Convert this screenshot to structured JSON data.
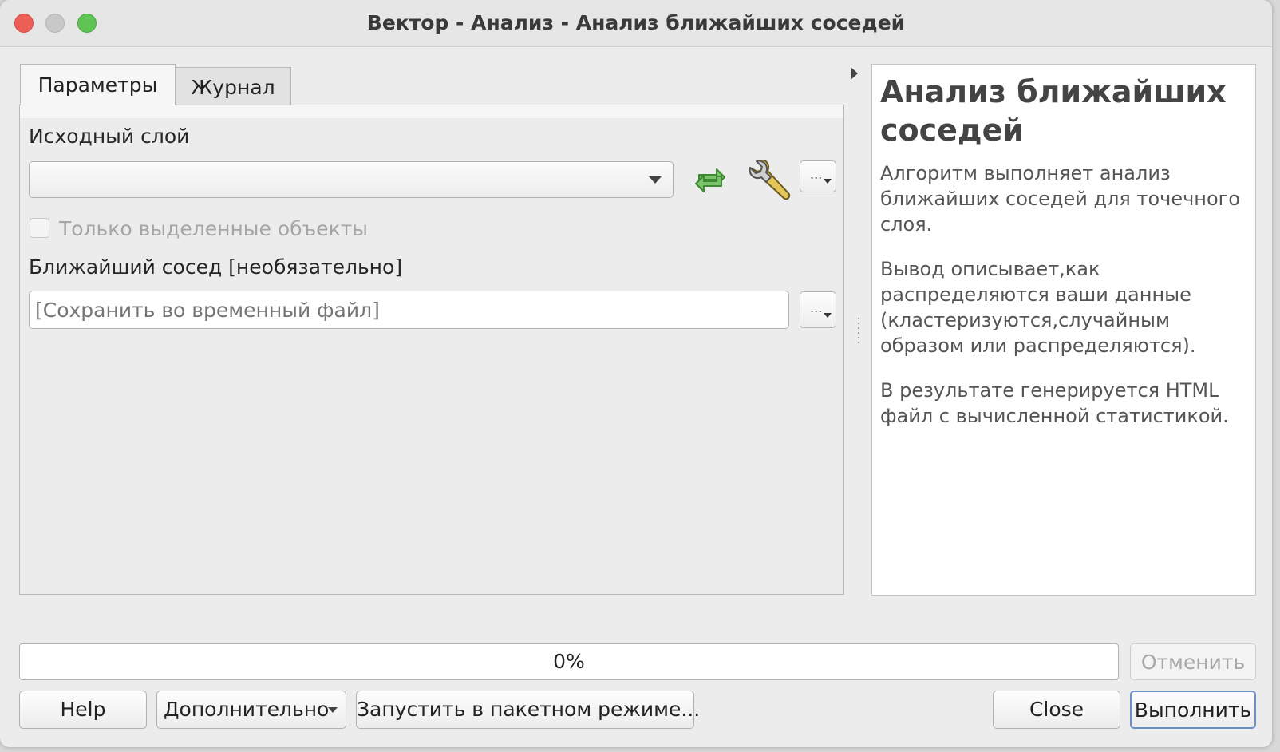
{
  "window": {
    "title": "Вектор - Анализ - Анализ ближайших соседей"
  },
  "tabs": [
    {
      "label": "Параметры",
      "active": true
    },
    {
      "label": "Журнал",
      "active": false
    }
  ],
  "params": {
    "input_layer_label": "Исходный слой",
    "input_layer_value": "",
    "selected_only_label": "Только выделенные объекты",
    "selected_only_checked": false,
    "output_label": "Ближайший сосед [необязательно]",
    "output_placeholder": "[Сохранить во временный файл]",
    "dots_label": "..."
  },
  "help": {
    "title": "Анализ ближайших соседей",
    "paragraphs": [
      "Алгоритм выполняет анализ ближайших соседей для точечного слоя.",
      "Вывод описывает,как распределяются ваши данные (кластеризуются,случайным образом или распределяются).",
      "В результате генерируется HTML файл с вычисленной статистикой."
    ]
  },
  "progress": {
    "value": 0,
    "text": "0%"
  },
  "buttons": {
    "cancel": "Отменить",
    "help": "Help",
    "advanced": "Дополнительно",
    "batch": "Запустить в пакетном режиме...",
    "close": "Close",
    "run": "Выполнить"
  },
  "colors": {
    "close": "#ec5f57",
    "minimize": "#c8c8c8",
    "maximize": "#5fc454",
    "default_button_border": "#6c8fc8"
  }
}
